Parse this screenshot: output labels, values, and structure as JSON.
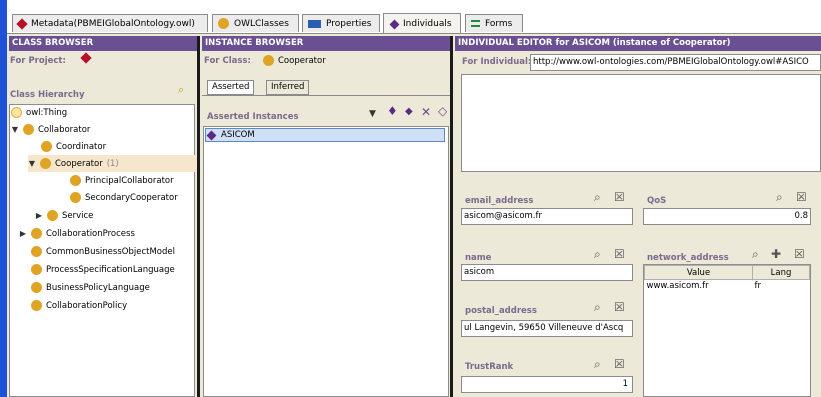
{
  "tabs": [
    {
      "label": "Metadata(PBMEIGlobalOntology.owl)",
      "icon": "metadata-diamond-icon"
    },
    {
      "label": "OWLClasses",
      "icon": "class-circle-icon"
    },
    {
      "label": "Properties",
      "icon": "properties-rect-icon"
    },
    {
      "label": "Individuals",
      "icon": "individuals-diamond-icon"
    },
    {
      "label": "Forms",
      "icon": "forms-icon"
    }
  ],
  "class_browser": {
    "header": "CLASS BROWSER",
    "for_project_label": "For Project:",
    "hierarchy_label": "Class Hierarchy",
    "tree": [
      {
        "label": "owl:Thing"
      },
      {
        "label": "Collaborator"
      },
      {
        "label": "Coordinator"
      },
      {
        "label": "Cooperator",
        "count": "(1)"
      },
      {
        "label": "PrincipalCollaborator"
      },
      {
        "label": "SecondaryCooperator"
      },
      {
        "label": "Service"
      },
      {
        "label": "CollaborationProcess"
      },
      {
        "label": "CommonBusinessObjectModel"
      },
      {
        "label": "ProcessSpecificationLanguage"
      },
      {
        "label": "BusinessPolicyLanguage"
      },
      {
        "label": "CollaborationPolicy"
      }
    ]
  },
  "instance_browser": {
    "header": "INSTANCE BROWSER",
    "for_class_label": "For Class:",
    "for_class_value": "Cooperator",
    "subtabs": [
      "Asserted",
      "Inferred"
    ],
    "list_label": "Asserted Instances",
    "instances": [
      "ASICOM"
    ]
  },
  "individual_editor": {
    "header": "INDIVIDUAL EDITOR for ASICOM   (instance of Cooperator)",
    "for_individual_label": "For Individual:",
    "for_individual_value": "http://www.owl-ontologies.com/PBMEIGlobalOntology.owl#ASICO",
    "fields": {
      "email_label": "email_address",
      "email_value": "asicom@asicom.fr",
      "qos_label": "QoS",
      "qos_value": "0.8",
      "name_label": "name",
      "name_value": "asicom",
      "network_label": "network_address",
      "network_col_value": "Value",
      "network_col_lang": "Lang",
      "network_rows": [
        {
          "value": "www.asicom.fr",
          "lang": "fr"
        }
      ],
      "postal_label": "postal_address",
      "postal_value": "ul Langevin, 59650 Villeneuve d'Ascq",
      "trustrank_label": "TrustRank",
      "trustrank_value": "1"
    }
  },
  "colors": {
    "header_purple": "#6a4f92",
    "strip_blue": "#1e52d6",
    "class_orange": "#e0a424",
    "instance_purple": "#5b2a86",
    "selection": "#f6e7cc"
  }
}
